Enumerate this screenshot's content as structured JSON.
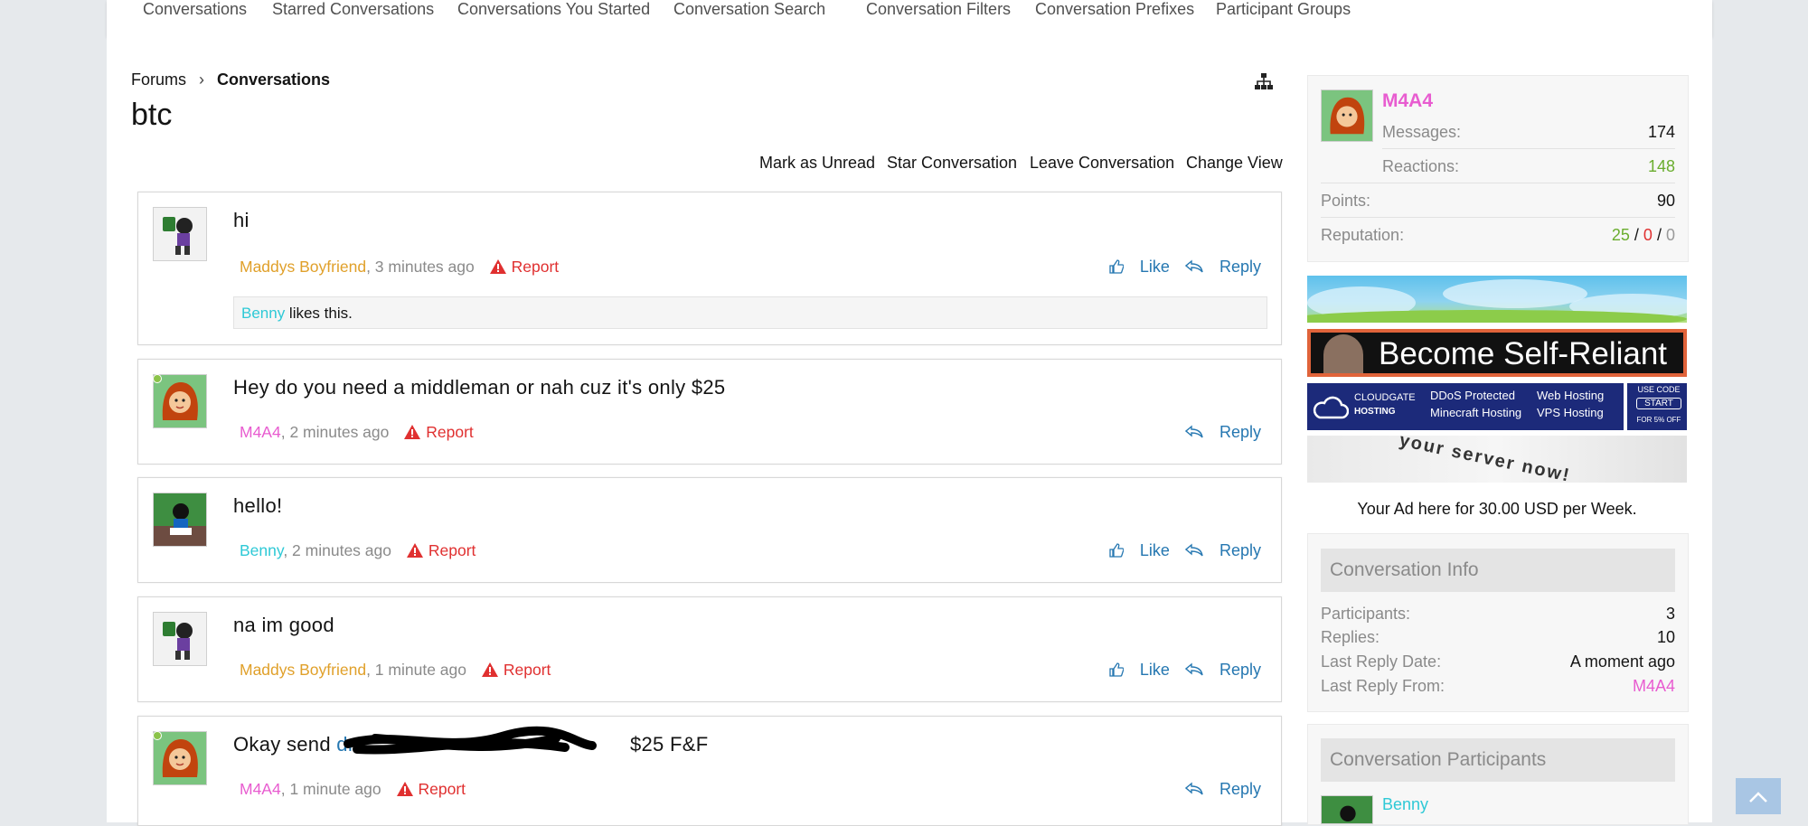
{
  "nav": {
    "items": [
      "Conversations",
      "Starred Conversations",
      "Conversations You Started",
      "Conversation Search",
      "Conversation Filters",
      "Conversation Prefixes",
      "Participant Groups"
    ]
  },
  "breadcrumb": {
    "root": "Forums",
    "current": "Conversations"
  },
  "title": "btc",
  "actions": {
    "mark_unread": "Mark as Unread",
    "star": "Star Conversation",
    "leave": "Leave Conversation",
    "change_view": "Change View"
  },
  "messages": [
    {
      "text": "hi",
      "author": "Maddys Boyfriend",
      "time": ", 3 minutes ago",
      "report": "Report",
      "like": "Like",
      "reply": "Reply",
      "likes_user": "Benny",
      "likes_text": " likes this."
    },
    {
      "text": "Hey do you need a middleman or nah cuz it's only $25",
      "author": "M4A4",
      "time": ", 2 minutes ago",
      "report": "Report",
      "reply": "Reply"
    },
    {
      "text": "hello!",
      "author": "Benny",
      "time": ", 2 minutes ago",
      "report": "Report",
      "like": "Like",
      "reply": "Reply"
    },
    {
      "text": "na im good",
      "author": "Maddys Boyfriend",
      "time": ", 1 minute ago",
      "report": "Report",
      "like": "Like",
      "reply": "Reply"
    },
    {
      "text_prefix": "Okay send ",
      "text_link": "dre",
      "text_suffix": "$25 F&F",
      "author": "M4A4",
      "time": ", 1 minute ago",
      "report": "Report",
      "reply": "Reply"
    }
  ],
  "profile": {
    "name": "M4A4",
    "messages_label": "Messages:",
    "messages": "174",
    "reactions_label": "Reactions:",
    "reactions": "148",
    "points_label": "Points:",
    "points": "90",
    "reputation_label": "Reputation:",
    "rep_pos": "25",
    "rep_neg": "0",
    "rep_neu": "0",
    "rep_sep": "/"
  },
  "ads": {
    "banner2": "Become Self-Reliant",
    "cloud_brand": "CLOUDGATE",
    "cloud_sub": "HOSTING",
    "cloud_f1": "DDoS Protected",
    "cloud_f2": "Web Hosting",
    "cloud_f3": "Minecraft Hosting",
    "cloud_f4": "VPS Hosting",
    "cloud_code": "USE CODE",
    "cloud_code_val": "START",
    "cloud_off": "FOR 5% OFF",
    "banner4": "your server now!",
    "ad_here": "Your Ad here for 30.00 USD per Week."
  },
  "conv_info": {
    "header": "Conversation Info",
    "participants_label": "Participants:",
    "participants": "3",
    "replies_label": "Replies:",
    "replies": "10",
    "last_date_label": "Last Reply Date:",
    "last_date": "A moment ago",
    "last_from_label": "Last Reply From:",
    "last_from": "M4A4"
  },
  "participants": {
    "header": "Conversation Participants",
    "first": "Benny"
  },
  "colors": {
    "link": "#2577b1",
    "report": "#e03030",
    "author_orange": "#e0a02a",
    "author_pink": "#e85cd0",
    "author_cyan": "#2ec9d6",
    "rep_green": "#6aad2e"
  }
}
